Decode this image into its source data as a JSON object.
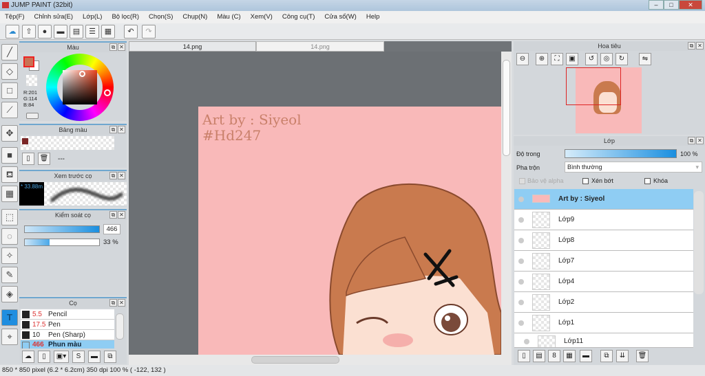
{
  "window": {
    "title": "JUMP PAINT (32bit)",
    "min": "–",
    "max": "□",
    "close": "✕"
  },
  "menu": [
    "Tệp(F)",
    "Chỉnh sửa(E)",
    "Lớp(L)",
    "Bộ lọc(R)",
    "Chọn(S)",
    "Chụp(N)",
    "Màu (C)",
    "Xem(V)",
    "Công cụ(T)",
    "Cửa sổ(W)",
    "Help"
  ],
  "toolbar_icons": [
    "cloud-icon",
    "share-icon",
    "speech-bubble-icon",
    "comment-icon",
    "document-icon",
    "list-icon",
    "checklist-icon"
  ],
  "tabs": [
    {
      "label": "14.png",
      "active": true
    },
    {
      "label": "14.png",
      "active": false
    }
  ],
  "color_panel": {
    "title": "Màu",
    "r": "R:201",
    "g": "G:114",
    "b": "B:84",
    "fg": "#c97254",
    "bg": "#ffffff"
  },
  "palette_panel": {
    "title": "Bảng màu",
    "swatch": "#7a2626",
    "sep": "---"
  },
  "brush_preview": {
    "title": "Xem trước cọ",
    "size": "* 33.88m"
  },
  "brush_control": {
    "title": "Kiểm soát cọ",
    "size": "466",
    "opacity": "33 %",
    "opacity_value": 33
  },
  "brush_panel": {
    "title": "Cọ",
    "items": [
      {
        "size": "5.5",
        "name": "Pencil"
      },
      {
        "size": "17.5",
        "name": "Pen"
      },
      {
        "size": "10",
        "name": "Pen (Sharp)"
      },
      {
        "size": "466",
        "name": "Phun màu",
        "selected": true
      }
    ]
  },
  "canvas": {
    "text1": "Art by : Siyeol",
    "text2": "#Hd247",
    "bg": "#f9b9b9"
  },
  "navigator": {
    "title": "Hoa tiêu"
  },
  "layers_panel": {
    "title": "Lớp",
    "opacity_label": "Độ trong",
    "opacity": "100 %",
    "blend_label": "Pha trộn",
    "blend": "Bình thường",
    "protect_alpha": "Bảo vệ alpha",
    "clip": "Xén bớt",
    "lock": "Khóa",
    "layers": [
      {
        "name": "Art by : Siyeol",
        "selected": true
      },
      {
        "name": "Lớp9"
      },
      {
        "name": "Lớp8"
      },
      {
        "name": "Lớp7"
      },
      {
        "name": "Lớp4"
      },
      {
        "name": "Lớp2"
      },
      {
        "name": "Lớp1"
      },
      {
        "name": "Lớp11"
      }
    ]
  },
  "status": "850 * 850 pixel  (6.2 * 6.2cm)  350 dpi  100 %  ( -122, 132 )"
}
